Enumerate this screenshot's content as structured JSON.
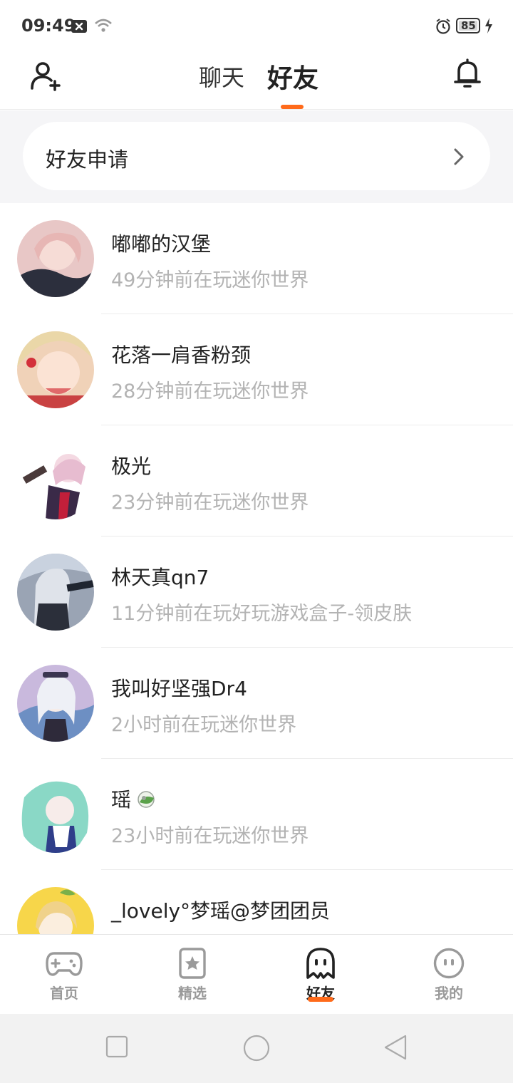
{
  "status_bar": {
    "time": "09:49",
    "battery": "85"
  },
  "header": {
    "tabs": [
      {
        "label": "聊天"
      },
      {
        "label": "好友"
      }
    ],
    "add_friend_icon": "add-user-icon",
    "notification_icon": "bell-icon"
  },
  "friend_request": {
    "label": "好友申请"
  },
  "friends": [
    {
      "name": "嘟嘟的汉堡",
      "status": "49分钟前在玩迷你世界",
      "avatar_color": "#e8c7c6"
    },
    {
      "name": "花落一肩香粉颈",
      "status": "28分钟前在玩迷你世界",
      "avatar_color": "#f0d2b8"
    },
    {
      "name": "极光",
      "status": "23分钟前在玩迷你世界",
      "avatar_color": "#f4d9e2"
    },
    {
      "name": "林天真qn7",
      "status": "11分钟前在玩好玩游戏盒子-领皮肤",
      "avatar_color": "#9aa4b4"
    },
    {
      "name": "我叫好坚强Dr4",
      "status": "2小时前在玩迷你世界",
      "avatar_color": "#c9b9dd"
    },
    {
      "name": "瑶",
      "status": "23小时前在玩迷你世界",
      "avatar_color": "#8ad8c6"
    },
    {
      "name": "_lovely°梦瑶@梦团团员",
      "status": "",
      "avatar_color": "#f7d64a"
    }
  ],
  "bottom_nav": [
    {
      "label": "首页",
      "icon": "gamepad-icon"
    },
    {
      "label": "精选",
      "icon": "star-icon"
    },
    {
      "label": "好友",
      "icon": "ghost-icon"
    },
    {
      "label": "我的",
      "icon": "smiley-icon"
    }
  ],
  "colors": {
    "accent": "#ff6a1a",
    "secondary_text": "#b3b3b3"
  }
}
